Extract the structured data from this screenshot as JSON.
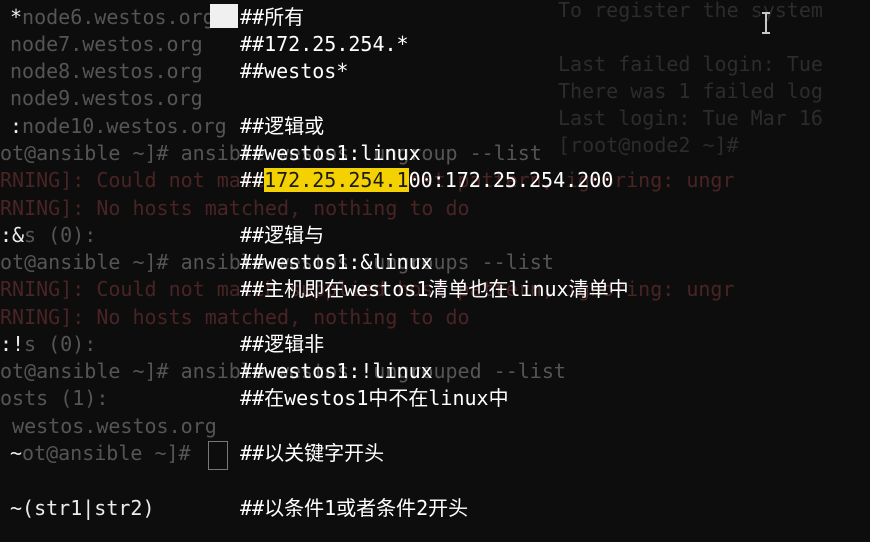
{
  "terminal": {
    "left_lines": [
      {
        "id": "l1",
        "text": "*"
      },
      {
        "id": "l1b",
        "text": "node6.westos.org"
      },
      {
        "id": "l2",
        "text": "node7.westos.org"
      },
      {
        "id": "l3",
        "text": "node8.westos.org"
      },
      {
        "id": "l4",
        "text": "node9.westos.org"
      },
      {
        "id": "l5a",
        "text": ":"
      },
      {
        "id": "l5b",
        "text": "node10.westos.org"
      },
      {
        "id": "l6",
        "text": "ot@ansible ~]# ansible westos  ungroup --list"
      },
      {
        "id": "l7",
        "text": "RNING]: Could not match supplied host pattern, ignoring: ungr"
      },
      {
        "id": "l8",
        "text": "RNING]: No hosts matched, nothing to do"
      },
      {
        "id": "l9a",
        "text": ":&"
      },
      {
        "id": "l9b",
        "text": "s (0):"
      },
      {
        "id": "l10",
        "text": "ot@ansible ~]# ansible westos  ungroups --list"
      },
      {
        "id": "l11",
        "text": "RNING]: Could not match supplied host pattern, ignoring: ungr"
      },
      {
        "id": "l12",
        "text": "RNING]: No hosts matched, nothing to do"
      },
      {
        "id": "l13a",
        "text": ":!"
      },
      {
        "id": "l13b",
        "text": "s (0):"
      },
      {
        "id": "l14",
        "text": "ot@ansible ~]# ansible westos  ungrouped --list"
      },
      {
        "id": "l15",
        "text": "osts (1):"
      },
      {
        "id": "l16",
        "text": " westos.westos.org"
      },
      {
        "id": "l17a",
        "text": "~"
      },
      {
        "id": "l17b",
        "text": "ot@ansible ~]#"
      },
      {
        "id": "l18",
        "text": "~(str1|str2)"
      }
    ],
    "right_pane": [
      "To register the system",
      "",
      "Last failed login: Tue",
      "There was 1 failed log",
      "Last login: Tue Mar 16",
      "[root@node2 ~]#"
    ],
    "notes": {
      "n1": "##所有",
      "n2": "##172.25.254.*",
      "n3": "##westos*",
      "n4": "##逻辑或",
      "n5": "##westos1:linux",
      "n6_prefix": "##",
      "n6_highlight": "172.25.254.1",
      "n6_suffix": "00:172.25.254.200",
      "n7": "##逻辑与",
      "n8": "##westos1:&linux",
      "n9": "##主机即在westos1清单也在linux清单中",
      "n10": "##逻辑非",
      "n11": "##westos1:!linux",
      "n12": "##在westos1中不在linux中",
      "n13": "##以关键字开头",
      "n14": "##以条件1或者条件2开头"
    }
  }
}
